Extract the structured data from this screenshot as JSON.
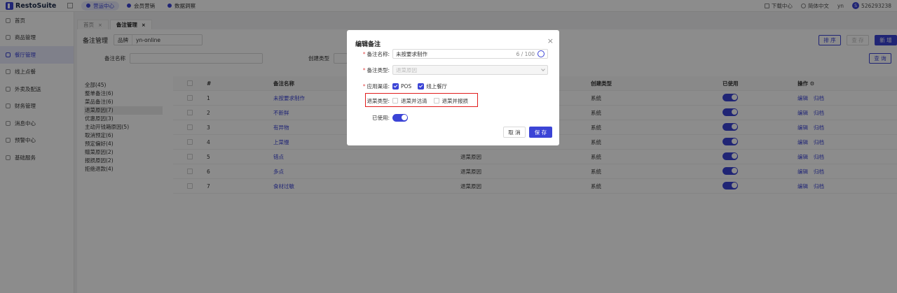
{
  "app": {
    "name": "RestoSuite"
  },
  "topnav": {
    "tabs": [
      {
        "label": "营运中心"
      },
      {
        "label": "会员营销"
      },
      {
        "label": "数据洞察"
      }
    ],
    "download": "下载中心",
    "language": "简体中文",
    "user_short": "yn",
    "avatar_letter": "S",
    "account": "526293238"
  },
  "sidebar": {
    "items": [
      {
        "label": "首页"
      },
      {
        "label": "商品管理"
      },
      {
        "label": "餐厅管理"
      },
      {
        "label": "线上点餐"
      },
      {
        "label": "外卖及配送"
      },
      {
        "label": "财务管理"
      },
      {
        "label": "消息中心"
      },
      {
        "label": "预警中心"
      },
      {
        "label": "基础服务"
      }
    ]
  },
  "pagetabs": [
    {
      "label": "首页"
    },
    {
      "label": "备注管理"
    }
  ],
  "header": {
    "title": "备注管理",
    "brand_label": "品牌",
    "brand_value": "yn-online",
    "sort_btn": "排 序",
    "archive_btn": "查 存",
    "add_btn": "新 增",
    "query_btn": "查 询"
  },
  "filter": {
    "name_label": "备注名称",
    "create_type_label": "创建类型"
  },
  "categories": [
    "全部(45)",
    "整单备注(6)",
    "菜品备注(6)",
    "退菜原因(7)",
    "优惠原因(3)",
    "主动开钱箱原因(5)",
    "取消预定(6)",
    "预定偏好(4)",
    "赠菜原因(2)",
    "报损原因(2)",
    "拒绝退款(4)"
  ],
  "table": {
    "headers": {
      "no": "#",
      "name": "备注名称",
      "type": "",
      "create_type": "创建类型",
      "used": "已使用",
      "ops": "操作"
    },
    "rows": [
      {
        "no": "1",
        "name": "未按要求制作",
        "type": "",
        "create": "系统"
      },
      {
        "no": "2",
        "name": "不新鲜",
        "type": "",
        "create": "系统"
      },
      {
        "no": "3",
        "name": "有异物",
        "type": "",
        "create": "系统"
      },
      {
        "no": "4",
        "name": "上菜慢",
        "type": "",
        "create": "系统"
      },
      {
        "no": "5",
        "name": "错点",
        "type": "退菜原因",
        "create": "系统"
      },
      {
        "no": "6",
        "name": "多点",
        "type": "退菜原因",
        "create": "系统"
      },
      {
        "no": "7",
        "name": "食材过敏",
        "type": "退菜原因",
        "create": "系统"
      }
    ],
    "edit_label": "编辑",
    "archive_label": "归档"
  },
  "modal": {
    "title": "编辑备注",
    "name_label": "备注名称:",
    "name_value": "未按要求制作",
    "name_count": "6 / 100",
    "type_label": "备注类型:",
    "type_value": "退菜原因",
    "channel_label": "应用渠道:",
    "channel_pos": "POS",
    "channel_online": "线上餐厅",
    "refund_label": "退菜类型:",
    "refund_opt1": "退菜并沽清",
    "refund_opt2": "退菜并报损",
    "used_label": "已使用:",
    "cancel": "取 消",
    "save": "保 存"
  },
  "colors": {
    "accent": "#3b44d6",
    "highlight": "#e11d1d"
  }
}
